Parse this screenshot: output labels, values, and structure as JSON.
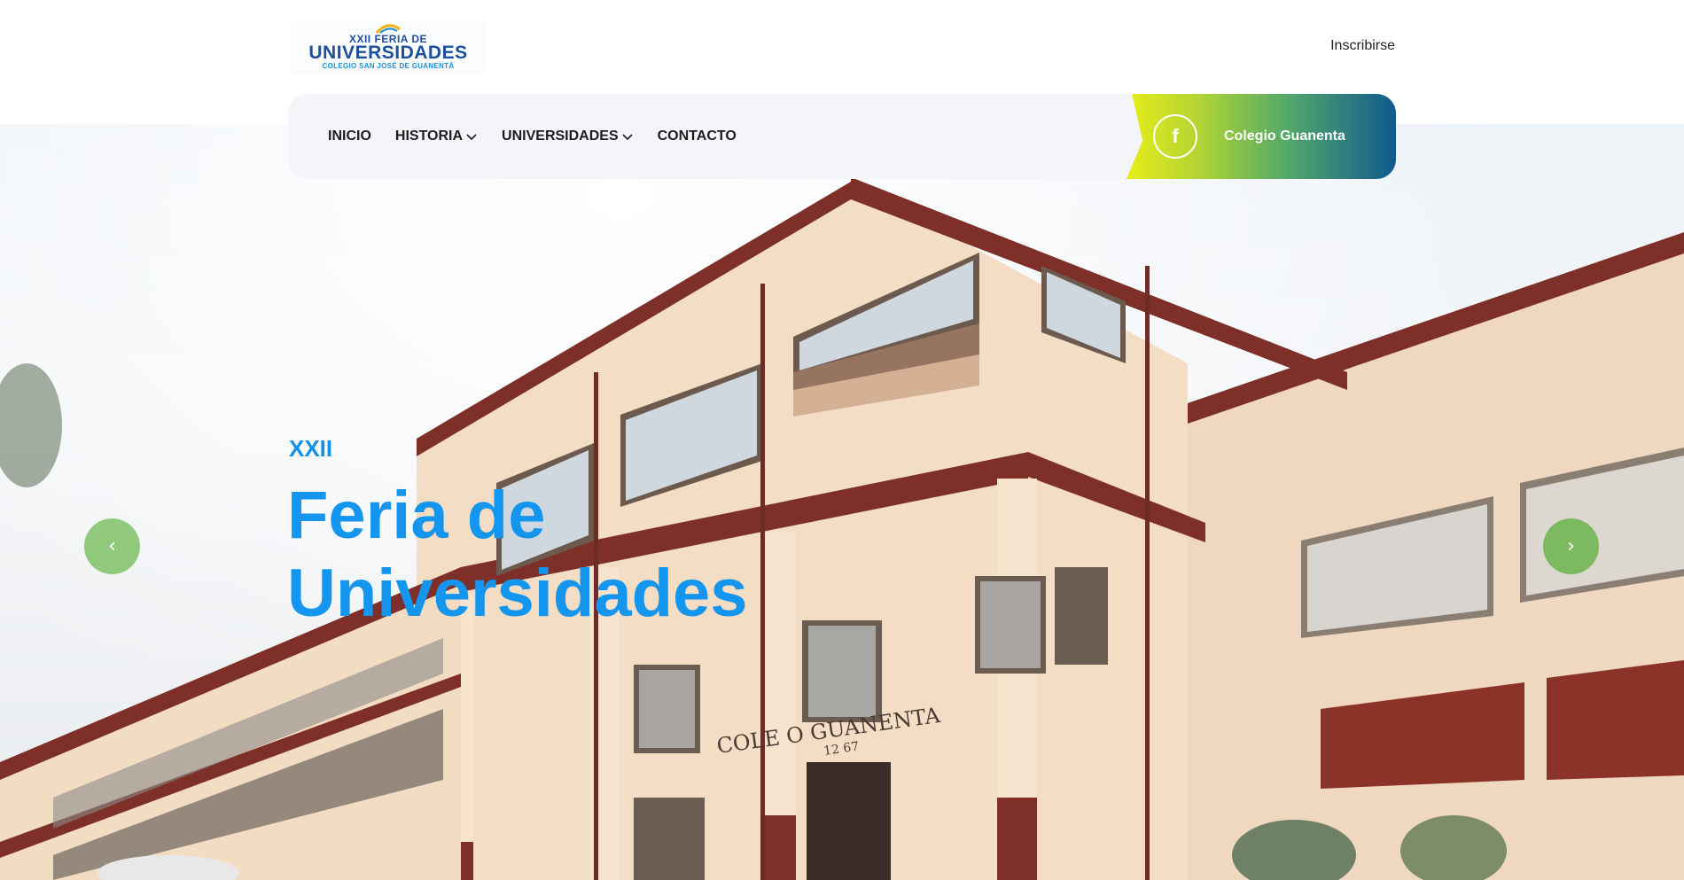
{
  "header": {
    "logo": {
      "line1": "XXII FERIA DE",
      "line2": "UNIVERSIDADES",
      "line3": "COLEGIO SAN JOSÉ DE GUANENTÁ"
    },
    "signup_link": "Inscribirse"
  },
  "nav": {
    "items": [
      {
        "label": "INICIO",
        "has_dropdown": false
      },
      {
        "label": "HISTORIA",
        "has_dropdown": true
      },
      {
        "label": "UNIVERSIDADES",
        "has_dropdown": true
      },
      {
        "label": "CONTACTO",
        "has_dropdown": false
      }
    ],
    "social": {
      "icon": "facebook-icon",
      "glyph": "f",
      "label": "Colegio Guanenta"
    }
  },
  "hero": {
    "kicker": "XXII",
    "headline": "Feria de Universidades",
    "building_sign": "COLE O GUANENTA",
    "building_year": "12 67",
    "prev_icon": "chevron-left-icon",
    "next_icon": "chevron-right-icon",
    "prev_glyph": "‹",
    "next_glyph": "›"
  },
  "colors": {
    "headline_blue": "#1495ee",
    "nav_bg": "#f4f5f8",
    "fb_gradient_start": "#e6ed1a",
    "fb_gradient_end": "#105a8f",
    "arrow_green": "#7bbf60",
    "wall_cream": "#f2dcc2",
    "trim_maroon": "#7e3028"
  }
}
